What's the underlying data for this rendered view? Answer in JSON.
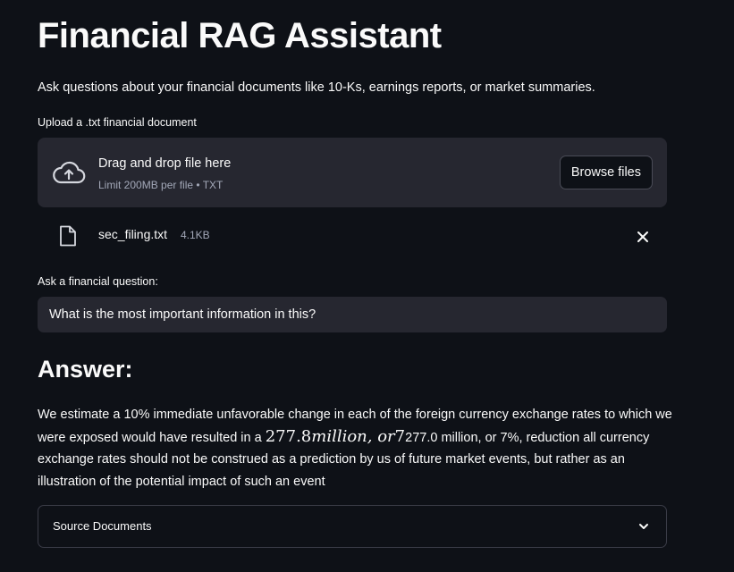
{
  "page": {
    "title": "Financial RAG Assistant",
    "subtitle": "Ask questions about your financial documents like 10-Ks, earnings reports, or market summaries."
  },
  "uploader": {
    "label": "Upload a .txt financial document",
    "drop_text": "Drag and drop file here",
    "limit_text": "Limit 200MB per file • TXT",
    "browse_label": "Browse files",
    "icon": "cloud-upload-icon"
  },
  "uploaded_file": {
    "name": "sec_filing.txt",
    "size": "4.1KB",
    "icon": "file-icon",
    "remove_icon": "close-icon"
  },
  "question": {
    "label": "Ask a financial question:",
    "value": "What is the most important information in this?"
  },
  "answer": {
    "heading": "Answer:",
    "text_before": "We estimate a 10% immediate unfavorable change in each of the foreign currency exchange rates to which we were exposed would have resulted in a ",
    "math_number": "277.8",
    "math_word": "million, or",
    "math_tail": "7",
    "text_after": "277.0 million, or 7%, reduction all currency exchange rates should not be construed as a prediction by us of future market events, but rather as an illustration of the potential impact of such an event"
  },
  "sources": {
    "label": "Source Documents",
    "icon": "chevron-down-icon"
  },
  "colors": {
    "background": "#0e1117",
    "panel": "#262730",
    "text": "#fafafa",
    "muted": "#a3a8b8"
  }
}
